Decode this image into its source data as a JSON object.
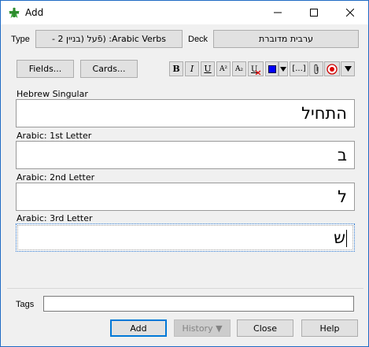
{
  "window": {
    "title": "Add",
    "minimize_icon": "minimize-icon",
    "maximize_icon": "maximize-icon",
    "close_icon": "close-icon"
  },
  "top_bar": {
    "type_label": "Type",
    "type_value": "Arabic Verbs: (פֿעל (בניין 2 -",
    "deck_label": "Deck",
    "deck_value": "ערבית מדוברת"
  },
  "buttons": {
    "fields": "Fields...",
    "cards": "Cards..."
  },
  "toolbar": {
    "bold": "B",
    "italic": "I",
    "underline": "U",
    "superscript": "A²",
    "subscript": "A₂",
    "cloze": "[...]",
    "text_color": "#0000ff",
    "items": [
      "bold",
      "italic",
      "underline",
      "superscript",
      "subscript",
      "clear-formatting-icon",
      "text-color",
      "color-dropdown-icon",
      "cloze",
      "paperclip-icon",
      "record-audio-icon",
      "more-dropdown-icon"
    ]
  },
  "fields": [
    {
      "label": "Hebrew Singular",
      "value": "התחיל"
    },
    {
      "label": "Arabic: 1st Letter",
      "value": "ב"
    },
    {
      "label": "Arabic: 2nd Letter",
      "value": "ל"
    },
    {
      "label": "Arabic: 3rd Letter",
      "value": "ש"
    }
  ],
  "tags": {
    "label": "Tags",
    "value": ""
  },
  "footer": {
    "add": "Add",
    "history": "History ▼",
    "close": "Close",
    "help": "Help"
  }
}
